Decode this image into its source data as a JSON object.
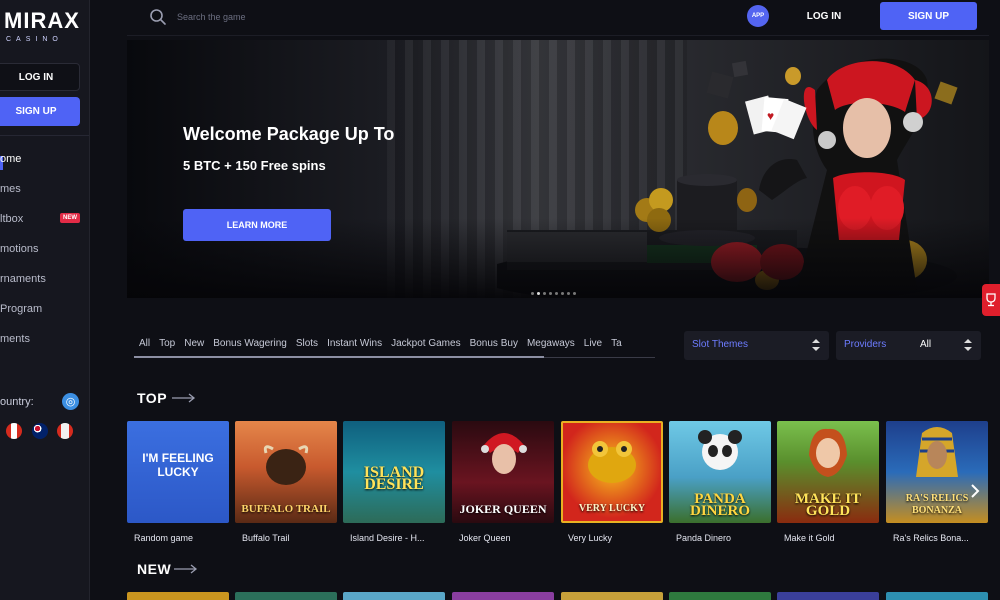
{
  "brand": {
    "name": "MIRAX",
    "sub": "CASINO"
  },
  "sidebar": {
    "login_label": "LOG IN",
    "signup_label": "SIGN UP",
    "nav": [
      {
        "label": "ome"
      },
      {
        "label": "mes"
      },
      {
        "label": "ltbox",
        "badge": "NEW"
      },
      {
        "label": "motions"
      },
      {
        "label": "rnaments"
      },
      {
        "label": "Program"
      },
      {
        "label": "ments"
      }
    ],
    "country_label": "ountry:"
  },
  "topbar": {
    "search_placeholder": "Search the game",
    "app_label": "APP",
    "login_label": "LOG IN",
    "signup_label": "SIGN UP"
  },
  "banner": {
    "title": "Welcome Package Up To",
    "subtitle": "5 BTC + 150 Free spins",
    "cta": "LEARN MORE"
  },
  "categories": [
    "All",
    "Top",
    "New",
    "Bonus Wagering",
    "Slots",
    "Instant Wins",
    "Jackpot Games",
    "Bonus Buy",
    "Megaways",
    "Live",
    "Ta"
  ],
  "filters": {
    "slot_themes": {
      "label": "Slot Themes"
    },
    "providers": {
      "label": "Providers",
      "value": "All"
    }
  },
  "sections": {
    "top": "TOP",
    "new": "NEW"
  },
  "games": [
    {
      "name": "Random game",
      "art": "I'M FEELING LUCKY"
    },
    {
      "name": "Buffalo Trail",
      "art": "BUFFALO TRAIL"
    },
    {
      "name": "Island Desire - H...",
      "art": "ISLAND DESIRE"
    },
    {
      "name": "Joker Queen",
      "art": "JOKER QUEEN"
    },
    {
      "name": "Very Lucky",
      "art": "VERY LUCKY"
    },
    {
      "name": "Panda Dinero",
      "art": "PANDA DINERO"
    },
    {
      "name": "Make it Gold",
      "art": "MAKE IT GOLD"
    },
    {
      "name": "Ra's Relics Bona...",
      "art": "RA'S RELICS BONANZA"
    }
  ],
  "colors": {
    "accent": "#4f63f5",
    "badge_red": "#e22b46",
    "background": "#0e0f15"
  }
}
